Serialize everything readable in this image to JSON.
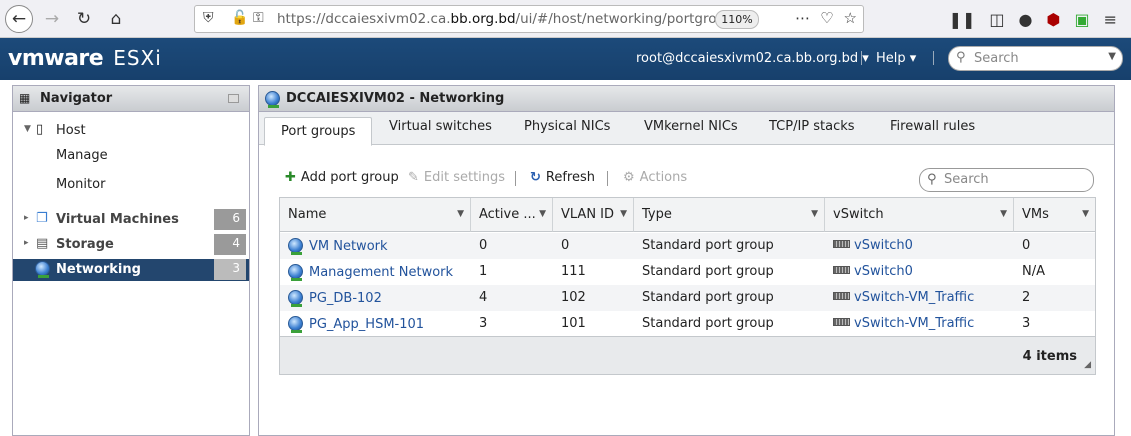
{
  "browser": {
    "url_prefix": "https://dccaiesxivm02.ca.",
    "url_domain": "bb.org.bd",
    "url_path": "/ui/#/host/networking/portgroups",
    "zoom": "110%"
  },
  "header": {
    "logo_vm": "vmware",
    "logo_product": "ESXi",
    "user": "root@dccaiesxivm02.ca.bb.org.bd",
    "help": "Help",
    "search_placeholder": "Search"
  },
  "navigator": {
    "title": "Navigator",
    "host": "Host",
    "host_children": [
      "Manage",
      "Monitor"
    ],
    "items": [
      {
        "label": "Virtual Machines",
        "count": "6"
      },
      {
        "label": "Storage",
        "count": "4"
      },
      {
        "label": "Networking",
        "count": "3"
      }
    ]
  },
  "main": {
    "title": "DCCAIESXIVM02 - Networking",
    "tabs": [
      "Port groups",
      "Virtual switches",
      "Physical NICs",
      "VMkernel NICs",
      "TCP/IP stacks",
      "Firewall rules"
    ],
    "toolbar": {
      "add": "Add port group",
      "edit": "Edit settings",
      "refresh": "Refresh",
      "actions": "Actions",
      "search_placeholder": "Search"
    },
    "columns": [
      "Name",
      "Active ...",
      "VLAN ID",
      "Type",
      "vSwitch",
      "VMs"
    ],
    "rows": [
      {
        "name": "VM Network",
        "active": "0",
        "vlan": "0",
        "type": "Standard port group",
        "vswitch": "vSwitch0",
        "vms": "0"
      },
      {
        "name": "Management Network",
        "active": "1",
        "vlan": "111",
        "type": "Standard port group",
        "vswitch": "vSwitch0",
        "vms": "N/A"
      },
      {
        "name": "PG_DB-102",
        "active": "4",
        "vlan": "102",
        "type": "Standard port group",
        "vswitch": "vSwitch-VM_Traffic",
        "vms": "2"
      },
      {
        "name": "PG_App_HSM-101",
        "active": "3",
        "vlan": "101",
        "type": "Standard port group",
        "vswitch": "vSwitch-VM_Traffic",
        "vms": "3"
      }
    ],
    "item_count": "4 items"
  }
}
